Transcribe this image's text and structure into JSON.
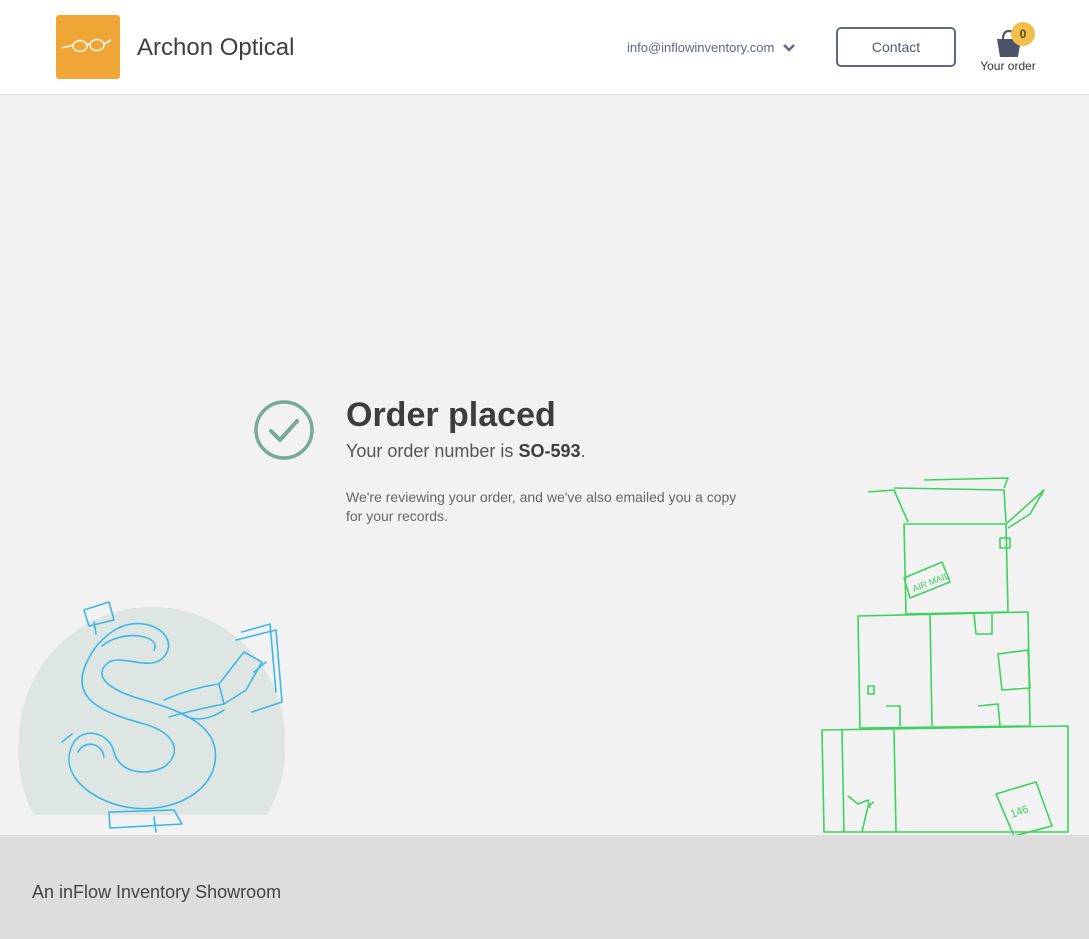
{
  "header": {
    "store_name": "Archon Optical",
    "logo_icon": "eyeglasses-icon",
    "account_email": "info@inflowinventory.com",
    "contact_label": "Contact",
    "cart_count": "0",
    "cart_label": "Your order"
  },
  "confirmation": {
    "title": "Order placed",
    "order_prefix": "Your order number is ",
    "order_number": "SO-593",
    "order_suffix": ".",
    "message": "We're reviewing your order, and we've also emailed you a copy for your records.",
    "status_icon": "check-circle-icon"
  },
  "illustrations": {
    "left_box_text": "",
    "right_label_1": "AIR MAIL",
    "right_label_2": "146"
  },
  "footer": {
    "text": "An inFlow Inventory Showroom"
  },
  "colors": {
    "logo_bg": "#f0a637",
    "badge": "#f0bf4f",
    "check": "#78a898",
    "boxes": "#3dd160",
    "money": "#3fb6e8",
    "circle_bg": "#dde6e2"
  }
}
